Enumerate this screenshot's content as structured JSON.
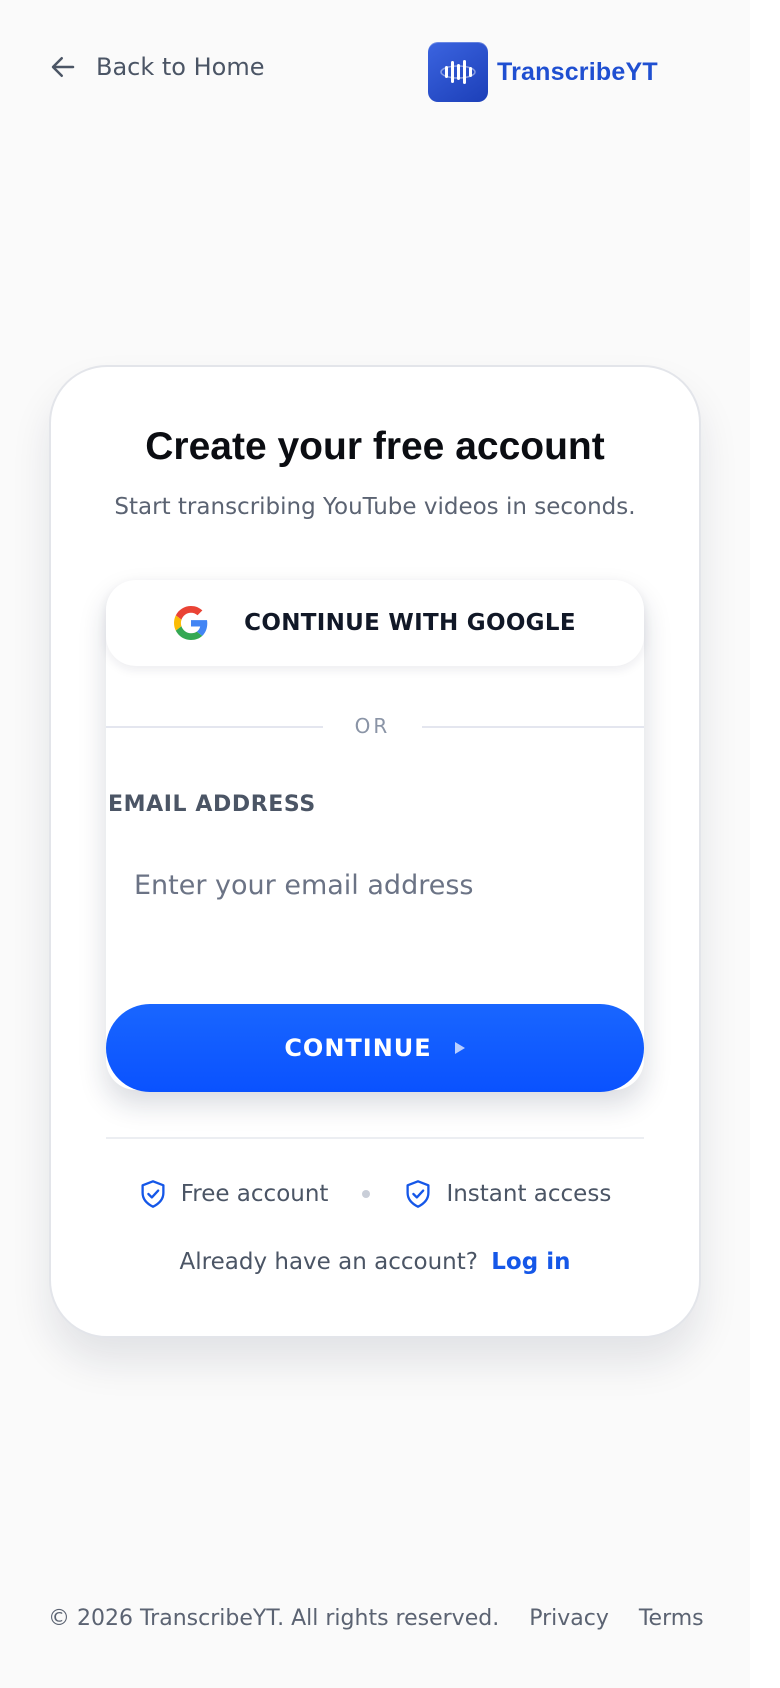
{
  "header": {
    "back_label": "Back to Home",
    "brand_name": "TranscribeYT"
  },
  "card": {
    "title": "Create your free account",
    "subtitle": "Start transcribing YouTube videos in seconds.",
    "google_button_label": "CONTINUE WITH GOOGLE",
    "divider_text": "OR",
    "email_label": "EMAIL ADDRESS",
    "email_placeholder": "Enter your email address",
    "email_value": "",
    "continue_label": "CONTINUE",
    "features": [
      {
        "icon": "shield-check-icon",
        "label": "Free account"
      },
      {
        "icon": "shield-check-icon",
        "label": "Instant access"
      }
    ],
    "login_prompt": "Already have an account?",
    "login_link": "Log in"
  },
  "footer": {
    "copyright": "© 2026 TranscribeYT. All rights reserved.",
    "links": [
      "Privacy",
      "Terms"
    ]
  },
  "colors": {
    "accent": "#0a52ff",
    "brand": "#1f4fd1",
    "link": "#1557e8",
    "background": "#fafafa"
  }
}
